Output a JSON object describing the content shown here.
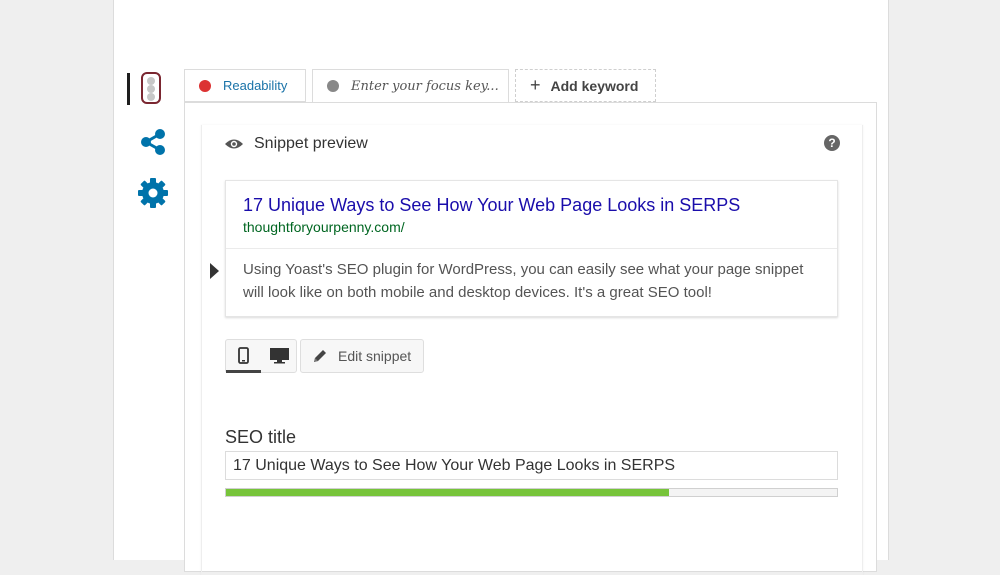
{
  "tabs": {
    "readability": {
      "label": "Readability",
      "status_color": "#dc3232"
    },
    "focus_keyword": {
      "placeholder": "Enter your focus key...",
      "status_color": "#888888"
    },
    "add_keyword": {
      "plus": "+",
      "label": "Add keyword"
    }
  },
  "snippet": {
    "header": "Snippet preview",
    "help_glyph": "?",
    "serp_title": "17 Unique Ways to See How Your Web Page Looks in SERPS",
    "serp_url": "thoughtforyourpenny.com/",
    "serp_description": "Using Yoast's SEO plugin for WordPress, you can easily see what your page snippet will look like on both mobile and desktop devices. It's a great SEO tool!",
    "edit_button": "Edit snippet"
  },
  "seo_title": {
    "label": "SEO title",
    "value": "17 Unique Ways to See How Your Web Page Looks in SERPS",
    "progress_fraction": 0.725,
    "progress_color": "#77c43a"
  },
  "icons": {
    "rail": [
      "traffic-light-icon",
      "share-icon",
      "gear-icon"
    ],
    "accent": "#0073aa"
  }
}
